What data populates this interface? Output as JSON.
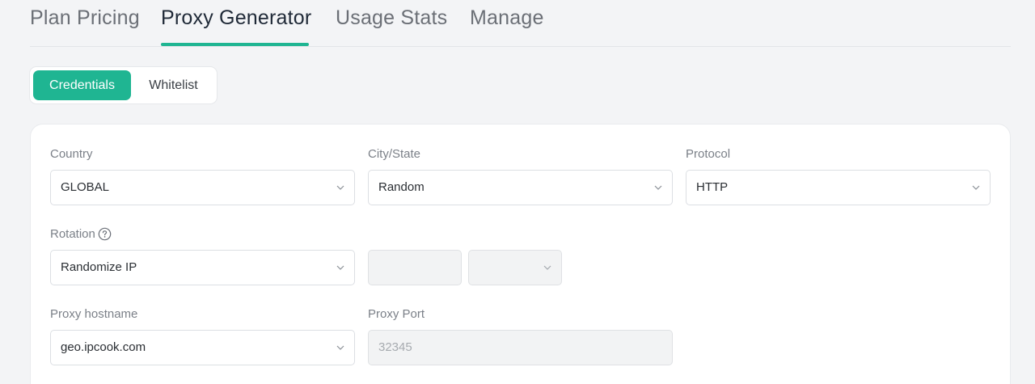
{
  "tabs": [
    {
      "label": "Plan Pricing"
    },
    {
      "label": "Proxy Generator"
    },
    {
      "label": "Usage Stats"
    },
    {
      "label": "Manage"
    }
  ],
  "active_tab": "Proxy Generator",
  "auth_toggle": {
    "options": [
      "Credentials",
      "Whitelist"
    ],
    "selected": "Credentials"
  },
  "form": {
    "country": {
      "label": "Country",
      "value": "GLOBAL"
    },
    "city_state": {
      "label": "City/State",
      "value": "Random"
    },
    "protocol": {
      "label": "Protocol",
      "value": "HTTP"
    },
    "rotation": {
      "label": "Rotation",
      "value": "Randomize IP",
      "duration_value": "",
      "unit_value": ""
    },
    "proxy_hostname": {
      "label": "Proxy hostname",
      "value": "geo.ipcook.com"
    },
    "proxy_port": {
      "label": "Proxy Port",
      "value": "32345"
    }
  },
  "colors": {
    "accent": "#1fb592",
    "background": "#f3f4f6"
  },
  "icons": {
    "help": "question-circle-icon",
    "dropdown": "chevron-down-icon"
  }
}
